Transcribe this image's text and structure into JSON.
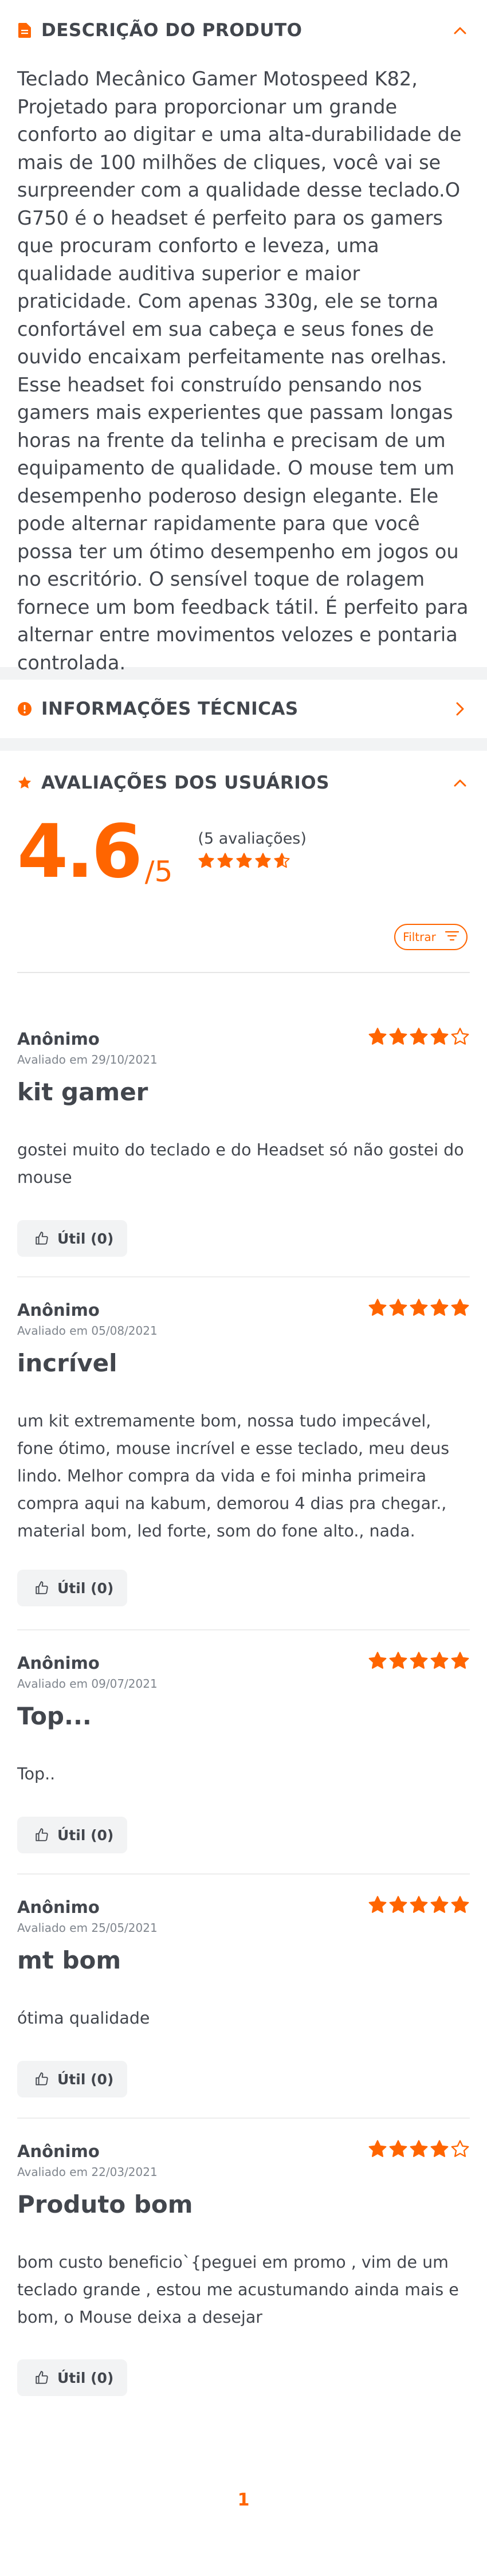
{
  "description": {
    "title": "DESCRIÇÃO DO PRODUTO",
    "text": "Teclado Mecânico Gamer Motospeed K82, Projetado para proporcionar um grande conforto ao digitar e uma alta-durabilidade de mais de 100 milhões de cliques, você vai se surpreender com a qualidade desse teclado.O G750 é o headset é perfeito para os gamers que procuram conforto e leveza, uma qualidade auditiva superior e maior praticidade. Com apenas 330g, ele se torna confortável em sua cabeça e seus fones de ouvido encaixam perfeitamente nas orelhas. Esse headset foi construído pensando nos gamers mais experientes que passam longas horas na frente da telinha e precisam de um equipamento de qualidade. O mouse tem um desempenho poderoso design elegante. Ele pode alternar rapidamente para que você possa ter um ótimo desempenho em jogos ou no escritório. O sensível toque de rolagem fornece um bom feedback tátil. É perfeito para alternar entre movimentos velozes e pontaria controlada."
  },
  "tech": {
    "title": "INFORMAÇÕES TÉCNICAS"
  },
  "reviews_section": {
    "title": "AVALIAÇÕES DOS USUÁRIOS",
    "score": "4.6",
    "out_of": "/5",
    "count": "(5 avaliações)",
    "score_stars": 4.6,
    "filter_label": "Filtrar"
  },
  "reviews": [
    {
      "author": "Anônimo",
      "date": "Avaliado em 29/10/2021",
      "stars": 4,
      "title": "kit gamer",
      "text": "gostei muito do teclado e do Headset só não gostei do mouse",
      "useful": "Útil (0)"
    },
    {
      "author": "Anônimo",
      "date": "Avaliado em 05/08/2021",
      "stars": 5,
      "title": "incrível",
      "text": "um kit extremamente bom, nossa tudo impecável, fone ótimo, mouse incrível e esse teclado, meu deus lindo. Melhor compra da vida e foi minha primeira compra aqui na kabum, demorou 4 dias pra chegar., material bom, led forte, som do fone alto., nada.",
      "useful": "Útil (0)"
    },
    {
      "author": "Anônimo",
      "date": "Avaliado em 09/07/2021",
      "stars": 5,
      "title": "Top...",
      "text": "Top..",
      "useful": "Útil (0)"
    },
    {
      "author": "Anônimo",
      "date": "Avaliado em 25/05/2021",
      "stars": 5,
      "title": "mt bom",
      "text": "ótima qualidade",
      "useful": "Útil (0)"
    },
    {
      "author": "Anônimo",
      "date": "Avaliado em 22/03/2021",
      "stars": 4,
      "title": "Produto bom",
      "text": "bom custo beneficio`{peguei em promo , vim de um teclado grande , estou me acustumando ainda mais e bom, o Mouse deixa a desejar",
      "useful": "Útil (0)"
    }
  ],
  "pagination": {
    "current": "1"
  },
  "colors": {
    "accent": "#ff6500",
    "text": "#42464d",
    "muted": "#7f858d",
    "separator": "#f2f3f4"
  }
}
